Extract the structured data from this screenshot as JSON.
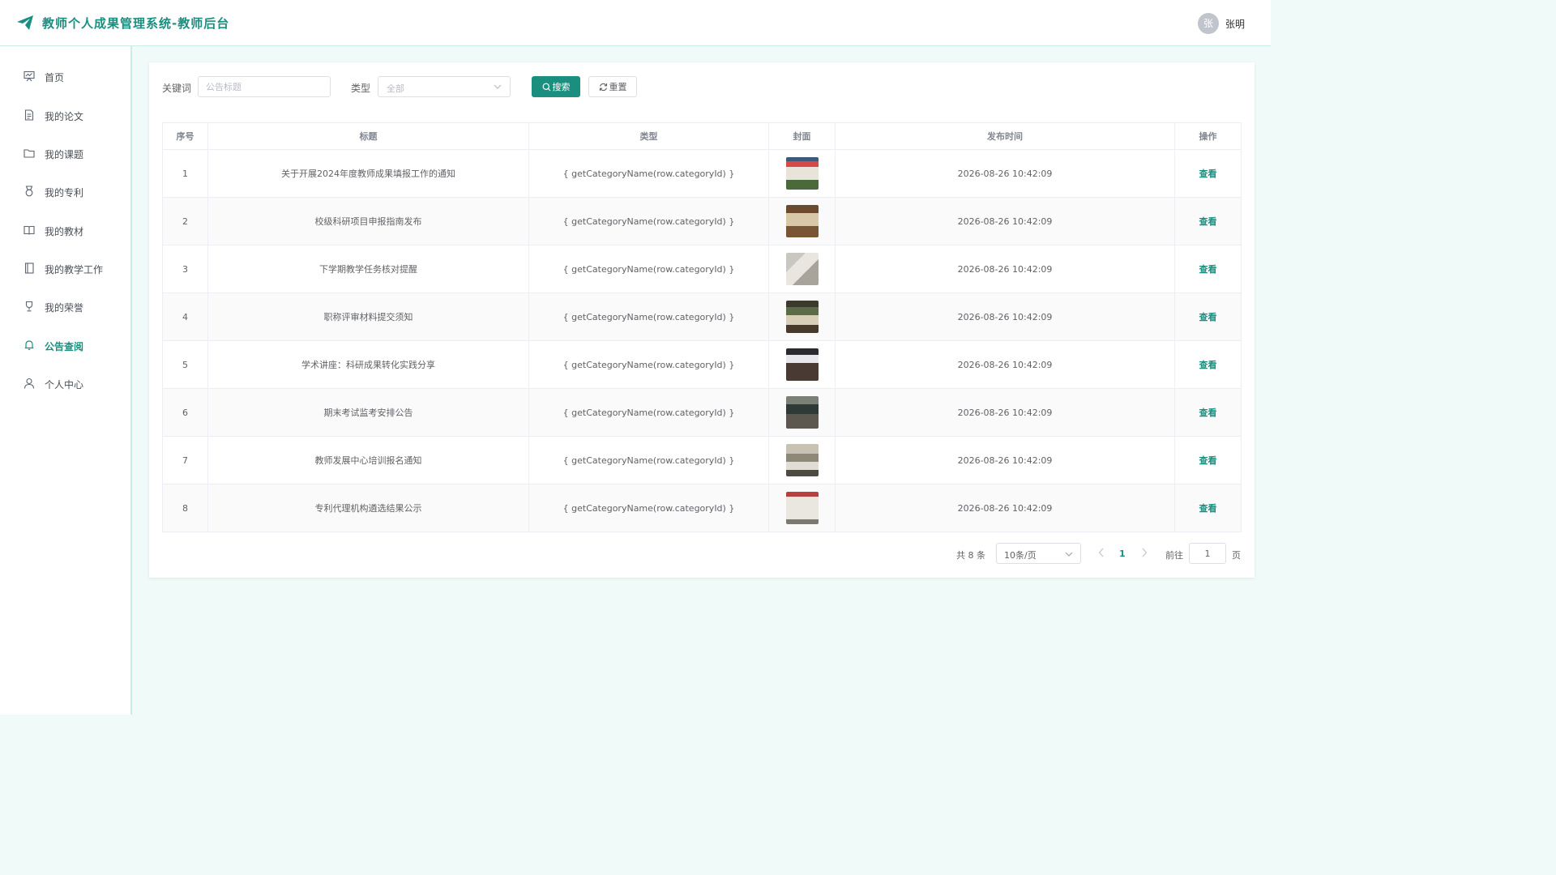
{
  "header": {
    "title": "教师个人成果管理系统-教师后台",
    "avatar_text": "张",
    "username": "张明"
  },
  "sidebar": {
    "items": [
      {
        "label": "首页",
        "icon": "dashboard-icon",
        "active": false
      },
      {
        "label": "我的论文",
        "icon": "document-icon",
        "active": false
      },
      {
        "label": "我的课题",
        "icon": "folder-icon",
        "active": false
      },
      {
        "label": "我的专利",
        "icon": "medal-icon",
        "active": false
      },
      {
        "label": "我的教材",
        "icon": "book-icon",
        "active": false
      },
      {
        "label": "我的教学工作",
        "icon": "notebook-icon",
        "active": false
      },
      {
        "label": "我的荣誉",
        "icon": "trophy-icon",
        "active": false
      },
      {
        "label": "公告查阅",
        "icon": "bell-icon",
        "active": true
      },
      {
        "label": "个人中心",
        "icon": "user-icon",
        "active": false
      }
    ]
  },
  "filters": {
    "keyword_label": "关键词",
    "keyword_placeholder": "公告标题",
    "keyword_value": "",
    "type_label": "类型",
    "type_value": "全部",
    "search_label": "搜索",
    "reset_label": "重置"
  },
  "table": {
    "headers": [
      "序号",
      "标题",
      "类型",
      "封面",
      "发布时间",
      "操作"
    ],
    "rows": [
      {
        "no": "1",
        "title": "关于开展2024年度教师成果填报工作的通知",
        "type": "{ getCategoryName(row.categoryId) }",
        "time": "2026-08-26 10:42:09",
        "action": "查看"
      },
      {
        "no": "2",
        "title": "校级科研项目申报指南发布",
        "type": "{ getCategoryName(row.categoryId) }",
        "time": "2026-08-26 10:42:09",
        "action": "查看"
      },
      {
        "no": "3",
        "title": "下学期教学任务核对提醒",
        "type": "{ getCategoryName(row.categoryId) }",
        "time": "2026-08-26 10:42:09",
        "action": "查看"
      },
      {
        "no": "4",
        "title": "职称评审材料提交须知",
        "type": "{ getCategoryName(row.categoryId) }",
        "time": "2026-08-26 10:42:09",
        "action": "查看"
      },
      {
        "no": "5",
        "title": "学术讲座：科研成果转化实践分享",
        "type": "{ getCategoryName(row.categoryId) }",
        "time": "2026-08-26 10:42:09",
        "action": "查看"
      },
      {
        "no": "6",
        "title": "期末考试监考安排公告",
        "type": "{ getCategoryName(row.categoryId) }",
        "time": "2026-08-26 10:42:09",
        "action": "查看"
      },
      {
        "no": "7",
        "title": "教师发展中心培训报名通知",
        "type": "{ getCategoryName(row.categoryId) }",
        "time": "2026-08-26 10:42:09",
        "action": "查看"
      },
      {
        "no": "8",
        "title": "专利代理机构遴选结果公示",
        "type": "{ getCategoryName(row.categoryId) }",
        "time": "2026-08-26 10:42:09",
        "action": "查看"
      }
    ]
  },
  "pagination": {
    "total_text": "共 8 条",
    "page_size": "10条/页",
    "current_page": "1",
    "goto_label": "前往",
    "goto_value": "1",
    "page_unit": "页"
  },
  "colors": {
    "accent": "#1a8f80",
    "background": "#f0faf8"
  }
}
